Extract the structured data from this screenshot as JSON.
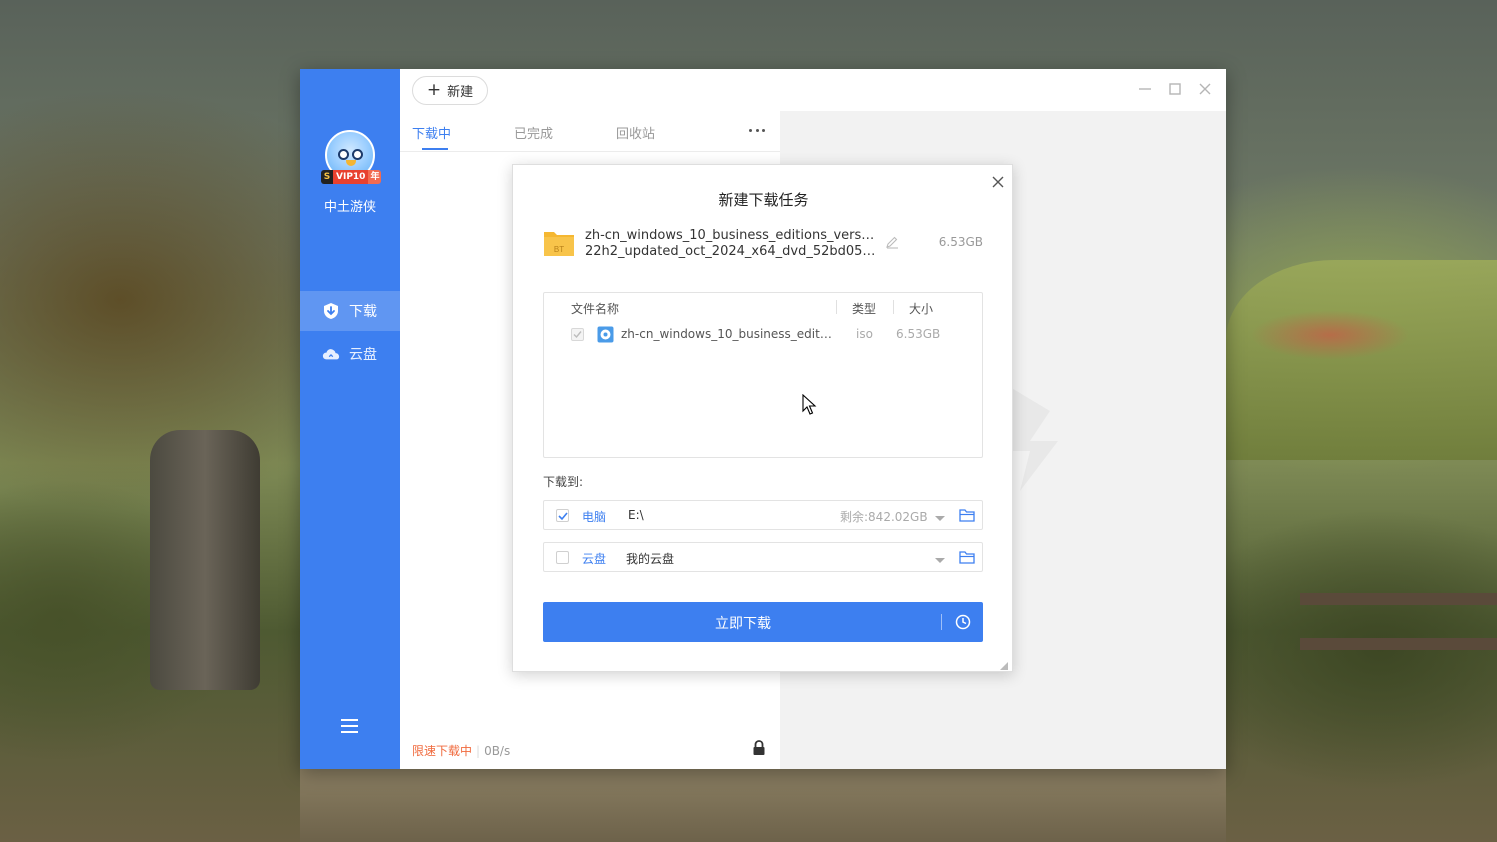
{
  "app": {
    "new_button_label": "新建",
    "user": {
      "name": "中土游侠",
      "vip_badge": "VIP10",
      "vip_s": "S",
      "vip_year": "年"
    },
    "sidebar": {
      "items": [
        {
          "label": "下载",
          "icon": "download-shield-icon",
          "active": true
        },
        {
          "label": "云盘",
          "icon": "cloud-icon",
          "active": false
        }
      ]
    },
    "tabs": [
      {
        "label": "下载中",
        "active": true
      },
      {
        "label": "已完成",
        "active": false
      },
      {
        "label": "回收站",
        "active": false
      }
    ],
    "status": {
      "limited": "限速下载中",
      "speed": "0B/s"
    }
  },
  "dialog": {
    "title": "新建下载任务",
    "torrent": {
      "name_line1": "zh-cn_windows_10_business_editions_version_",
      "name_line2": "22h2_updated_oct_2024_x64_dvd_52bd0537....",
      "size": "6.53GB",
      "icon_label": "BT"
    },
    "file_table": {
      "headers": {
        "name": "文件名称",
        "type": "类型",
        "size": "大小"
      },
      "rows": [
        {
          "name": "zh-cn_windows_10_business_editio...",
          "type": "iso",
          "size": "6.53GB",
          "checked": true
        }
      ]
    },
    "download_to_label": "下载到:",
    "destinations": {
      "pc": {
        "label": "电脑",
        "path": "E:\\",
        "free": "剩余:842.02GB",
        "checked": true
      },
      "cloud": {
        "label": "云盘",
        "path": "我的云盘",
        "checked": false
      }
    },
    "start_button_label": "立即下载"
  },
  "colors": {
    "accent": "#3d7ff0",
    "limited": "#f06a3d",
    "folder": "#f5b731"
  }
}
